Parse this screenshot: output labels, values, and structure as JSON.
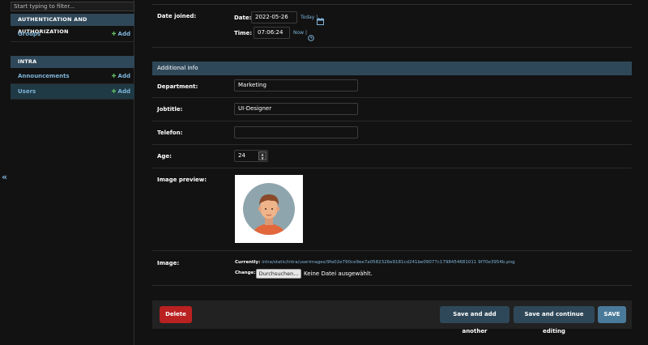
{
  "sidebar": {
    "filter_placeholder": "Start typing to filter...",
    "modules": [
      {
        "caption": "AUTHENTICATION AND AUTHORIZATION",
        "items": [
          {
            "label": "Groups",
            "add": "Add"
          }
        ]
      },
      {
        "caption": "INTRA",
        "items": [
          {
            "label": "Announcements",
            "add": "Add"
          },
          {
            "label": "Users",
            "add": "Add",
            "selected": true
          }
        ]
      }
    ],
    "collapse_glyph": "«"
  },
  "date_joined": {
    "label": "Date joined:",
    "date_label": "Date:",
    "date_value": "2022-05-26",
    "today_link": "Today |",
    "calendar_icon": "calendar-icon",
    "time_label": "Time:",
    "time_value": "07:06:24",
    "now_link": "Now |",
    "clock_icon": "clock-icon"
  },
  "additional_info": {
    "caption": "Additional info",
    "department": {
      "label": "Department:",
      "value": "Marketing"
    },
    "jobtitle": {
      "label": "Jobtitle:",
      "value": "UI-Designer"
    },
    "telefon": {
      "label": "Telefon:",
      "value": ""
    },
    "age": {
      "label": "Age:",
      "value": "24"
    },
    "image_preview": {
      "label": "Image preview:",
      "icon": "avatar-image"
    },
    "image": {
      "label": "Image:",
      "currently_label": "Currently:",
      "currently_path": "intra/static/intra/userimages/9fa02e790ce9ee7a0582326e9181cd241be09077c1798454681011 9f70e3954b.png",
      "change_label": "Change:",
      "browse_label": "Durchsuchen...",
      "no_file": "Keine Datei ausgewählt."
    }
  },
  "actions": {
    "delete": "Delete",
    "save_add_another": "Save and add another",
    "save_continue": "Save and continue editing",
    "save": "SAVE"
  },
  "colors": {
    "background": "#121212",
    "caption": "#2f4859",
    "link": "#7eb3d9",
    "add_plus": "#5fb85f",
    "delete": "#ba2121",
    "save": "#4a7a9a"
  }
}
